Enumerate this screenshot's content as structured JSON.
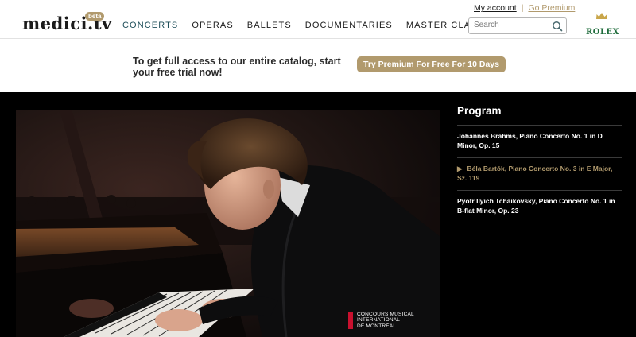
{
  "header": {
    "logo": "medici.tv",
    "beta_badge": "beta",
    "nav": [
      {
        "label": "CONCERTS",
        "active": true
      },
      {
        "label": "OPERAS",
        "active": false
      },
      {
        "label": "BALLETS",
        "active": false
      },
      {
        "label": "DOCUMENTARIES",
        "active": false
      },
      {
        "label": "MASTER CLASSES",
        "active": false
      }
    ],
    "account_link": "My account",
    "separator": "|",
    "premium_link": "Go Premium",
    "search_placeholder": "Search",
    "sponsor": "ROLEX"
  },
  "promo": {
    "text": "To get full access to our entire catalog, start your free trial now!",
    "button_label": "Try Premium For Free For 10 Days"
  },
  "video": {
    "watermark": [
      "CONCOURS MUSICAL",
      "INTERNATIONAL",
      "DE MONTRÉAL"
    ]
  },
  "program": {
    "title": "Program",
    "items": [
      {
        "label": "Johannes Brahms, Piano Concerto No. 1 in D Minor, Op. 15",
        "current": false
      },
      {
        "label": "Béla Bartók, Piano Concerto No. 3 in E Major, Sz. 119",
        "current": true
      },
      {
        "label": "Pyotr Ilyich Tchaikovsky, Piano Concerto No. 1 in B-flat Minor, Op. 23",
        "current": false
      }
    ]
  },
  "colors": {
    "accent_gold": "#b19a6d",
    "nav_active": "#1f4f5a",
    "rolex_green": "#1d6b3a",
    "watermark_red": "#c8102e"
  },
  "icons": [
    "search-icon",
    "crown-icon",
    "play-arrow-icon"
  ]
}
